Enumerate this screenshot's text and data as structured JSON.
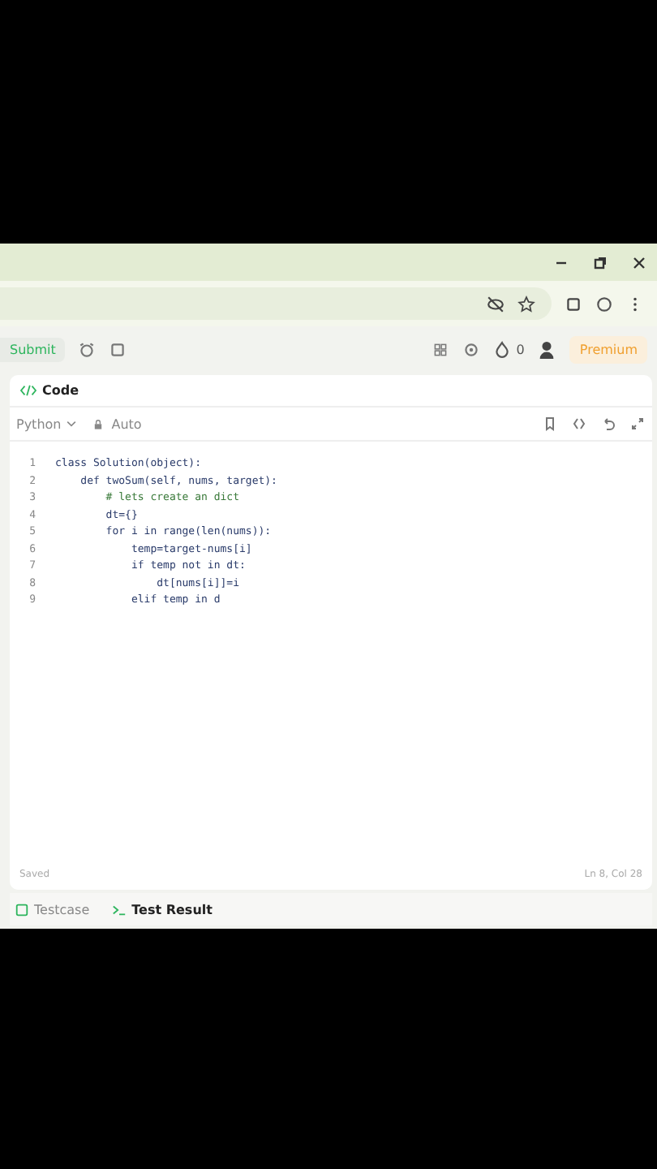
{
  "toolbar": {
    "submit": "Submit",
    "streak": "0",
    "premium": "Premium"
  },
  "code_panel": {
    "title": "Code",
    "language": "Python",
    "mode": "Auto",
    "lines": [
      {
        "number": "1",
        "text": "class Solution(object):",
        "kind": "code"
      },
      {
        "number": "2",
        "text": "    def twoSum(self, nums, target):",
        "kind": "code"
      },
      {
        "number": "3",
        "text": "        # lets create an dict",
        "kind": "comment"
      },
      {
        "number": "4",
        "text": "        dt={}",
        "kind": "code"
      },
      {
        "number": "5",
        "text": "        for i in range(len(nums)):",
        "kind": "code"
      },
      {
        "number": "6",
        "text": "            temp=target-nums[i]",
        "kind": "code"
      },
      {
        "number": "7",
        "text": "            if temp not in dt:",
        "kind": "code"
      },
      {
        "number": "8",
        "text": "                dt[nums[i]]=i",
        "kind": "code"
      },
      {
        "number": "9",
        "text": "            elif temp in d",
        "kind": "code"
      }
    ],
    "status": "Saved",
    "cursor": "Ln 8, Col 28"
  },
  "bottom_tabs": [
    {
      "label": "Testcase",
      "selected": false
    },
    {
      "label": "Test Result",
      "selected": true
    }
  ]
}
